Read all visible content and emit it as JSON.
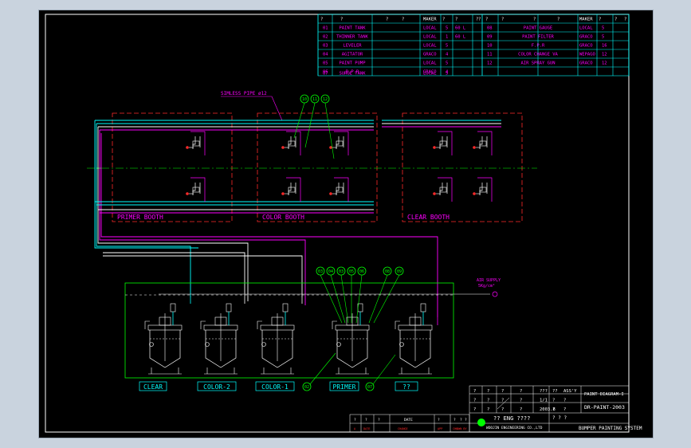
{
  "parts_table": {
    "header_left": [
      "?",
      "?",
      "?",
      "?",
      "MAKER",
      "?",
      "?",
      "?",
      "?"
    ],
    "header_right": [
      "?",
      "?",
      "?",
      "?",
      "MAKER",
      "?",
      "?",
      "?"
    ],
    "rows_left": [
      {
        "no": "01",
        "name": "PAINT TANK",
        "maker": "LOCAL",
        "qty": "5",
        "cap": "60 L"
      },
      {
        "no": "02",
        "name": "THINNER TANK",
        "maker": "LOCAL",
        "qty": "1",
        "cap": "60 L"
      },
      {
        "no": "03",
        "name": "LEVELER",
        "maker": "LOCAL",
        "qty": "5",
        "cap": ""
      },
      {
        "no": "04",
        "name": "AGITATOR",
        "maker": "GRACO",
        "qty": "4",
        "cap": ""
      },
      {
        "no": "05",
        "name": "PAINT PUMP",
        "maker": "LOCAL",
        "qty": "5",
        "cap": ""
      },
      {
        "no": "06",
        "name": "B.P.R",
        "maker": "GRACO",
        "qty": "4",
        "cap": ""
      },
      {
        "no": "07",
        "name": "SURGE TANK",
        "maker": "LOCAL",
        "qty": "5",
        "cap": ""
      }
    ],
    "rows_right": [
      {
        "no": "08",
        "name": "PAINT GAUGE",
        "maker": "LOCAL",
        "qty": "5"
      },
      {
        "no": "09",
        "name": "PAINT FILTER",
        "maker": "GRACO",
        "qty": "5"
      },
      {
        "no": "10",
        "name": "F.P.R",
        "maker": "GRACO",
        "qty": "16"
      },
      {
        "no": "11",
        "name": "COLOR CHANGE VA",
        "maker": "WEPAGO",
        "qty": "12"
      },
      {
        "no": "12",
        "name": "AIR SPRAY GUN",
        "maker": "GRACO",
        "qty": "12"
      },
      {
        "no": "",
        "name": "",
        "maker": "",
        "qty": ""
      },
      {
        "no": "",
        "name": "",
        "maker": "",
        "qty": ""
      }
    ]
  },
  "pipe_label": "SIMLESS PIPE ø12",
  "booths": [
    "PRIMER BOOTH",
    "COLOR BOOTH",
    "CLEAR BOOTH"
  ],
  "booth_balloons": [
    "10",
    "11",
    "12"
  ],
  "tank_balloons": [
    "03",
    "04",
    "03",
    "05",
    "06",
    "08",
    "09"
  ],
  "bottom_balloons": [
    "02",
    "07"
  ],
  "tanks": [
    "CLEAR",
    "COLOR-2",
    "COLOR-1",
    "PRIMER",
    "??"
  ],
  "air_supply": {
    "line1": "AIR SUPPLY",
    "line2": "5Kg/cm²"
  },
  "title_block": {
    "row1": [
      "?",
      "?",
      "?",
      "?",
      "???",
      "??",
      "ASS'Y"
    ],
    "row2": [
      "?",
      "?",
      "?",
      "?",
      "1/1",
      "?",
      "?"
    ],
    "row3": [
      "?",
      "?",
      "?",
      "?",
      "2003.8",
      "?",
      "?"
    ],
    "drawing_title": "PAINT DIAGRAM-I",
    "drawing_no": "DR-PAINT-2003",
    "company_kr": "?? ENG ????",
    "company_en": "WOOJIN ENGINEERING CO.,LTD",
    "project_label": "? ? ?",
    "project": "BUMPER PAINTING SYSTEM"
  },
  "revision_block": {
    "labels": [
      "?",
      "?",
      "?",
      "DATE",
      "?",
      "?",
      "?",
      "?",
      "REV"
    ],
    "marks": [
      "A",
      "DATE",
      "CHANGE",
      "APP",
      "CHK",
      "DWN BY"
    ]
  },
  "colors": {
    "cyan": "#00ffff",
    "magenta": "#ff00ff",
    "red": "#ff2a2a",
    "green": "#00ff00",
    "white": "#ffffff",
    "yellow": "#ffff00"
  }
}
